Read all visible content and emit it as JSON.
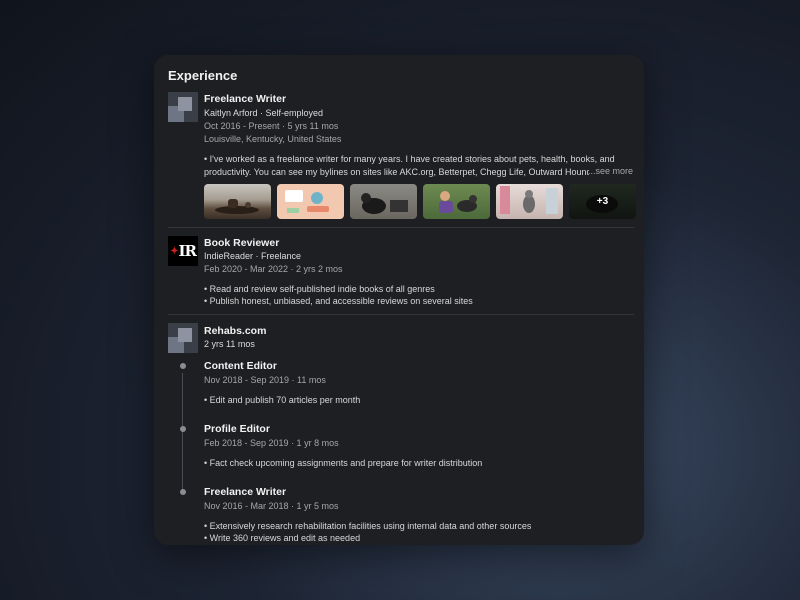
{
  "section": {
    "title": "Experience"
  },
  "job1": {
    "title": "Freelance Writer",
    "company": "Kaitlyn Arford · Self-employed",
    "dates": "Oct 2016 - Present · 5 yrs 11 mos",
    "location": "Louisville, Kentucky, United States",
    "desc_line1": "• I've worked as a freelance writer for many years. I have created stories about pets, health, books, and",
    "desc_line2": "productivity. You can see my bylines on sites like AKC.org, Betterpet, Chegg Life, Outward Hound, and more.",
    "see_more": "...see more",
    "more_count": "+3"
  },
  "job2": {
    "logo_text": "IR",
    "title": "Book Reviewer",
    "company": "IndieReader · Freelance",
    "dates": "Feb 2020 - Mar 2022 · 2 yrs 2 mos",
    "bullet1": "• Read and review self-published indie books of all genres",
    "bullet2": "• Publish honest, unbiased, and accessible reviews on several sites"
  },
  "job3": {
    "company": "Rehabs.com",
    "duration": "2 yrs 11 mos",
    "roles": [
      {
        "title": "Content Editor",
        "dates": "Nov 2018 - Sep 2019 · 11 mos",
        "bullet1": "• Edit and publish 70 articles per month"
      },
      {
        "title": "Profile Editor",
        "dates": "Feb 2018 - Sep 2019 · 1 yr 8 mos",
        "bullet1": "• Fact check upcoming assignments and prepare for writer distribution"
      },
      {
        "title": "Freelance Writer",
        "dates": "Nov 2016 - Mar 2018 · 1 yr 5 mos",
        "bullet1": "• Extensively research rehabilitation facilities using internal data and other sources",
        "bullet2": "• Write 360 reviews and edit as needed"
      }
    ]
  },
  "colors": {
    "card_bg": "#1e1f23",
    "text": "#e9e9ea",
    "muted": "#a6a7ab",
    "brand_red": "#d11f1f"
  }
}
